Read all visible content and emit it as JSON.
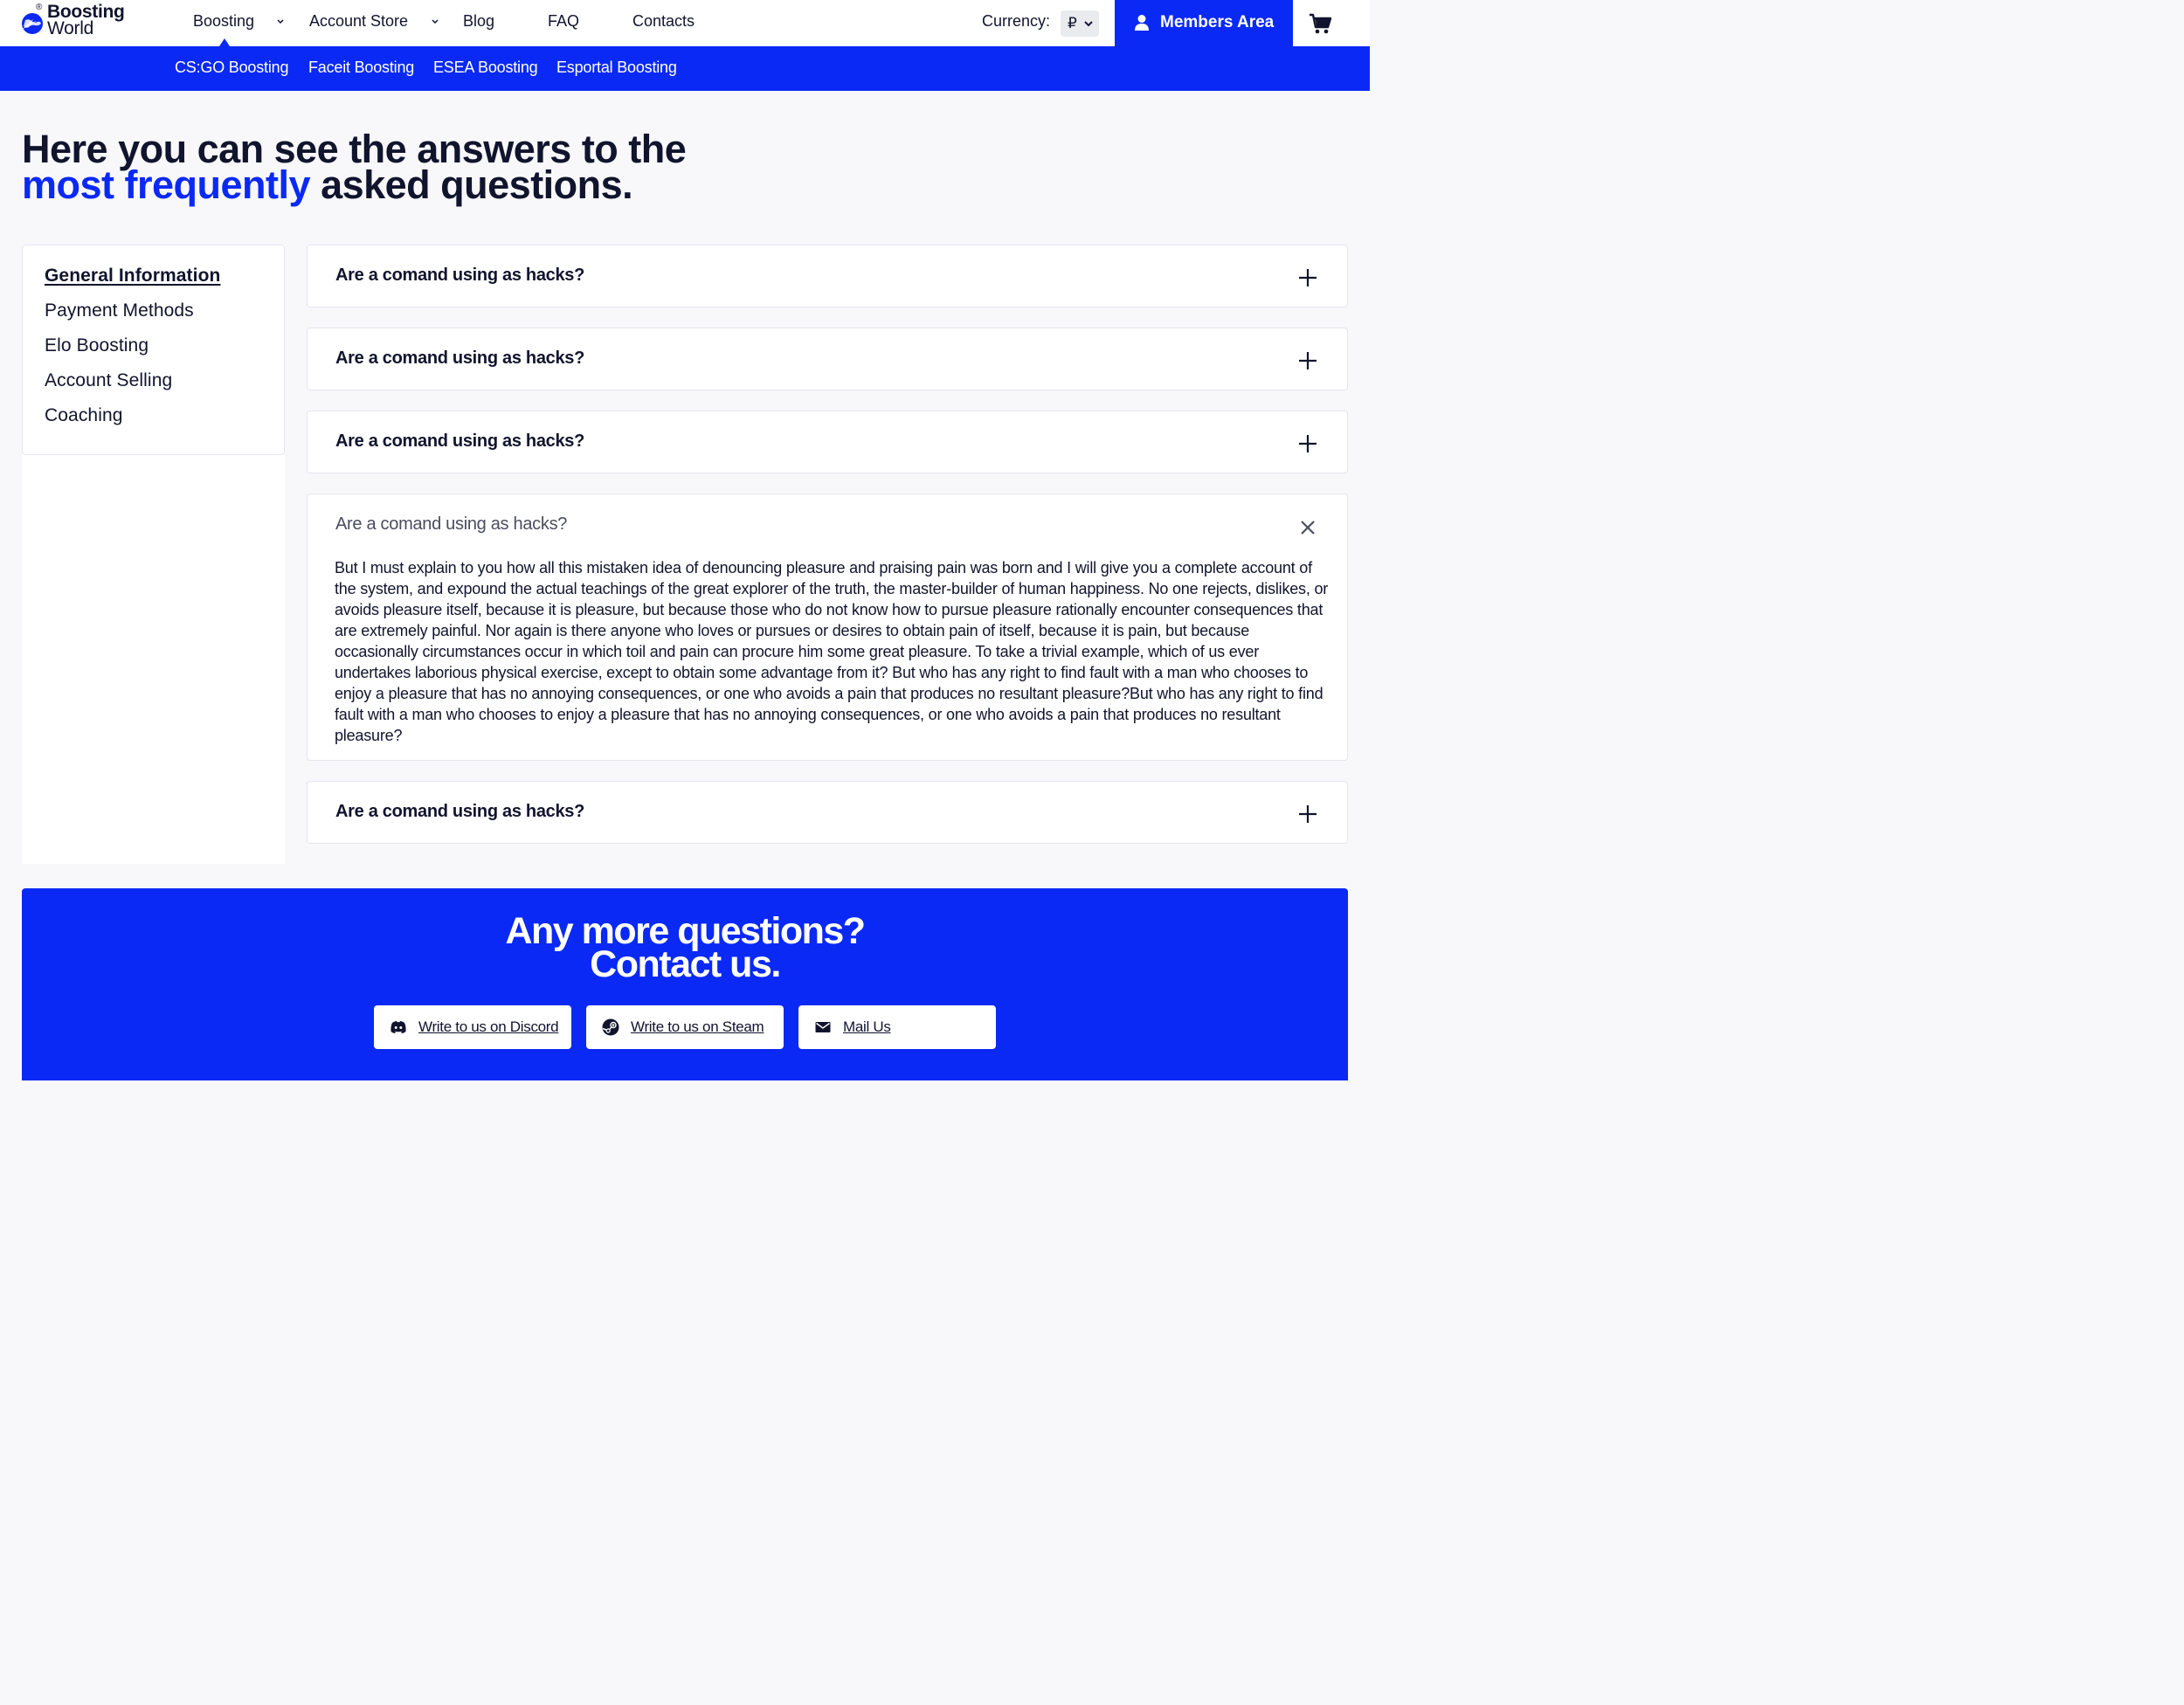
{
  "logo": {
    "line1": "Boosting",
    "line2": "World",
    "reg": "®"
  },
  "nav": {
    "items": [
      "Boosting",
      "Account Store",
      "Blog",
      "FAQ",
      "Contacts"
    ]
  },
  "currency": {
    "label": "Currency:",
    "value": "₽"
  },
  "members": {
    "label": "Members Area"
  },
  "subnav": {
    "items": [
      "CS:GO Boosting",
      "Faceit Boosting",
      "ESEA Boosting",
      "Esportal Boosting"
    ]
  },
  "title": {
    "line1": "Here you can see the answers to the",
    "accent": "most frequently",
    "rest": "asked questions."
  },
  "sidebar": {
    "items": [
      {
        "label": "General Information",
        "active": true
      },
      {
        "label": "Payment Methods",
        "active": false
      },
      {
        "label": "Elo Boosting",
        "active": false
      },
      {
        "label": "Account Selling",
        "active": false
      },
      {
        "label": "Coaching",
        "active": false
      }
    ]
  },
  "faq": {
    "items": [
      {
        "question": "Are a comand using as hacks?",
        "open": false
      },
      {
        "question": "Are a comand using as hacks?",
        "open": false
      },
      {
        "question": "Are a comand using as hacks?",
        "open": false
      },
      {
        "question": "Are a comand using as hacks?",
        "open": true,
        "answer": "But I must explain to you how all this mistaken idea of denouncing pleasure and praising pain was born and I will give you a complete account of the system, and expound the actual teachings of the great explorer of the truth, the master-builder of human happiness. No one rejects, dislikes, or avoids pleasure itself, because it is pleasure, but because those who do not know how to pursue pleasure rationally encounter consequences that are extremely painful. Nor again is there anyone who loves or pursues or desires to obtain pain of itself, because it is pain, but because occasionally circumstances occur in which toil and pain can procure him some great pleasure. To take a trivial example, which of us ever undertakes laborious physical exercise, except to obtain some advantage from it? But who has any right to find fault with a man who chooses to enjoy a pleasure that has no annoying consequences, or one who avoids a pain that produces no resultant pleasure?But who has any right to find fault with a man who chooses to enjoy a pleasure that has no annoying consequences, or one who avoids a pain that produces no resultant pleasure?"
      },
      {
        "question": "Are a comand using as hacks?",
        "open": false
      }
    ]
  },
  "contact": {
    "title_line1": "Any more questions?",
    "title_line2": "Contact us.",
    "buttons": [
      {
        "label": "Write to us on Discord",
        "icon": "discord-icon"
      },
      {
        "label": "Write to us on Steam",
        "icon": "steam-icon"
      },
      {
        "label": "Mail Us",
        "icon": "mail-icon"
      }
    ]
  },
  "colors": {
    "brand": "#0a29f5",
    "text": "#11142d",
    "background": "#f8f8fb"
  }
}
